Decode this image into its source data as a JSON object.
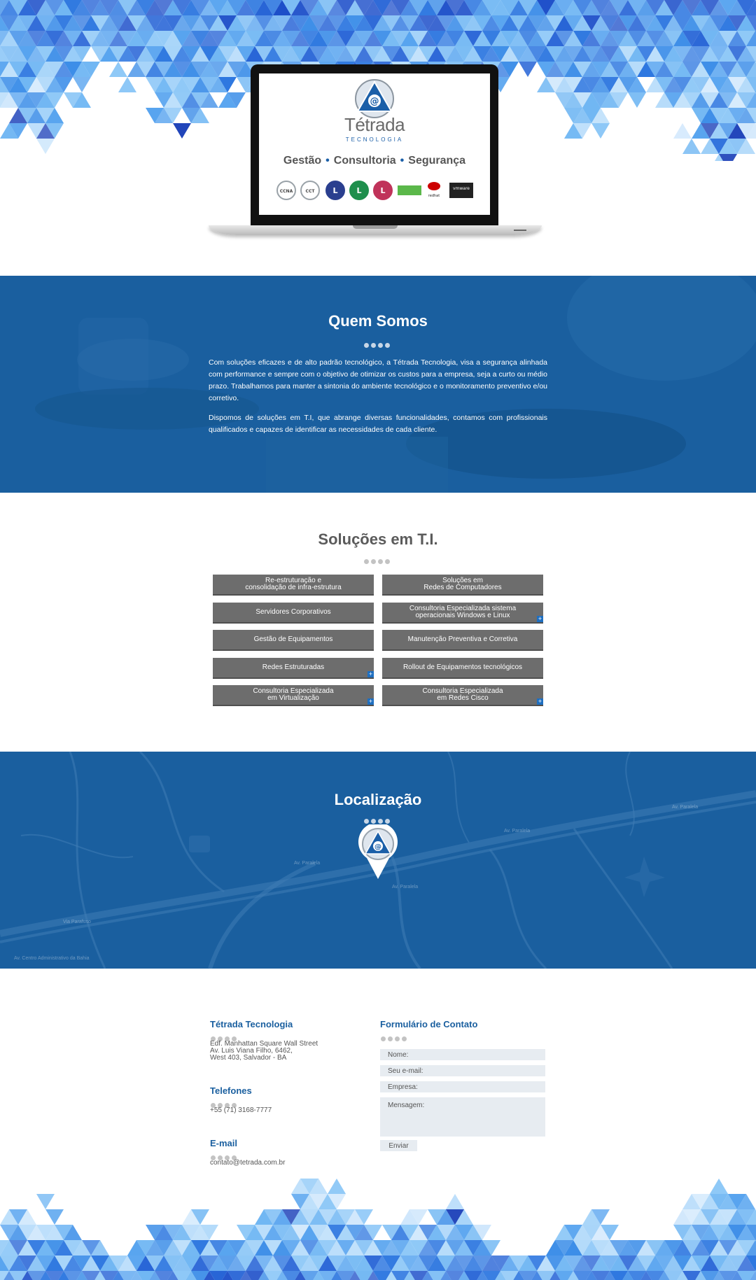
{
  "hero": {
    "screen": {
      "brand": "Tétrada",
      "brand_sub": "TECNOLOGIA",
      "tagline": [
        "Gestão",
        "Consultoria",
        "Segurança"
      ],
      "tagline_sep": "•",
      "certs": [
        {
          "label": "CCNA",
          "color": "#9aa2a8"
        },
        {
          "label": "CCT",
          "color": "#9aa2a8"
        },
        {
          "label": "L",
          "color": "#2a3f8f"
        },
        {
          "label": "L",
          "color": "#1f8f4d"
        },
        {
          "label": "L",
          "color": "#c0335a"
        },
        {
          "label": "",
          "color": "#5bb84a"
        },
        {
          "label": "redhat",
          "color": "#cc0000"
        },
        {
          "label": "vmware",
          "color": "#222222"
        }
      ]
    }
  },
  "about": {
    "title": "Quem Somos",
    "p1": "Com soluções eficazes e de alto padrão tecnológico, a Tétrada Tecnologia, visa a segurança alinhada com performance e sempre com o objetivo de otimizar os custos para a empresa, seja a curto ou médio prazo. Trabalhamos para manter a sintonia do ambiente tecnológico e o monitoramento preventivo e/ou corretivo.",
    "p2": "Dispomos de soluções em T.I, que abrange diversas funcionalidades, contamos com profissionais qualificados e capazes de identificar as necessidades de cada cliente."
  },
  "solutions": {
    "title": "Soluções em T.I.",
    "items": [
      {
        "l1": "Re-estruturação e",
        "l2": "consolidação de infra-estrutura",
        "plus": false
      },
      {
        "l1": "Soluções em",
        "l2": "Redes de Computadores",
        "plus": false
      },
      {
        "l1": "Servidores Corporativos",
        "l2": "",
        "plus": false
      },
      {
        "l1": "Consultoria Especializada sistema",
        "l2": "operacionais Windows e Linux",
        "plus": true
      },
      {
        "l1": "Gestão de Equipamentos",
        "l2": "",
        "plus": false
      },
      {
        "l1": "Manutenção Preventiva e Corretiva",
        "l2": "",
        "plus": false
      },
      {
        "l1": "Redes Estruturadas",
        "l2": "",
        "plus": true
      },
      {
        "l1": "Rollout de Equipamentos tecnológicos",
        "l2": "",
        "plus": false
      },
      {
        "l1": "Consultoria Especializada",
        "l2": "em Virtualização",
        "plus": true
      },
      {
        "l1": "Consultoria Especializada",
        "l2": "em Redes Cisco",
        "plus": true
      }
    ],
    "plus_glyph": "+"
  },
  "location": {
    "title": "Localização",
    "map_labels": [
      "Av. Paralela",
      "Av. Paralela",
      "Av. Paralela",
      "Via Parafuso",
      "Av. Centro Administrativo da Bahia",
      "Av. Paralela"
    ]
  },
  "contact": {
    "company_title": "Tétrada Tecnologia",
    "address": "Edf. Manhattan Square Wall Street\nAv. Luis Viana Filho, 6462,\nWest 403, Salvador - BA",
    "phones_title": "Telefones",
    "phone": "+55 (71) 3168-7777",
    "email_title": "E-mail",
    "email": "contato@tetrada.com.br",
    "form_title": "Formulário de Contato",
    "fields": {
      "name": "Nome:",
      "email": "Seu e-mail:",
      "company": "Empresa:",
      "message": "Mensagem:"
    },
    "submit": "Enviar"
  },
  "colors": {
    "brand_blue": "#1a5f9f",
    "button_grey": "#6d6d6d",
    "field_bg": "#e7ecf1"
  }
}
